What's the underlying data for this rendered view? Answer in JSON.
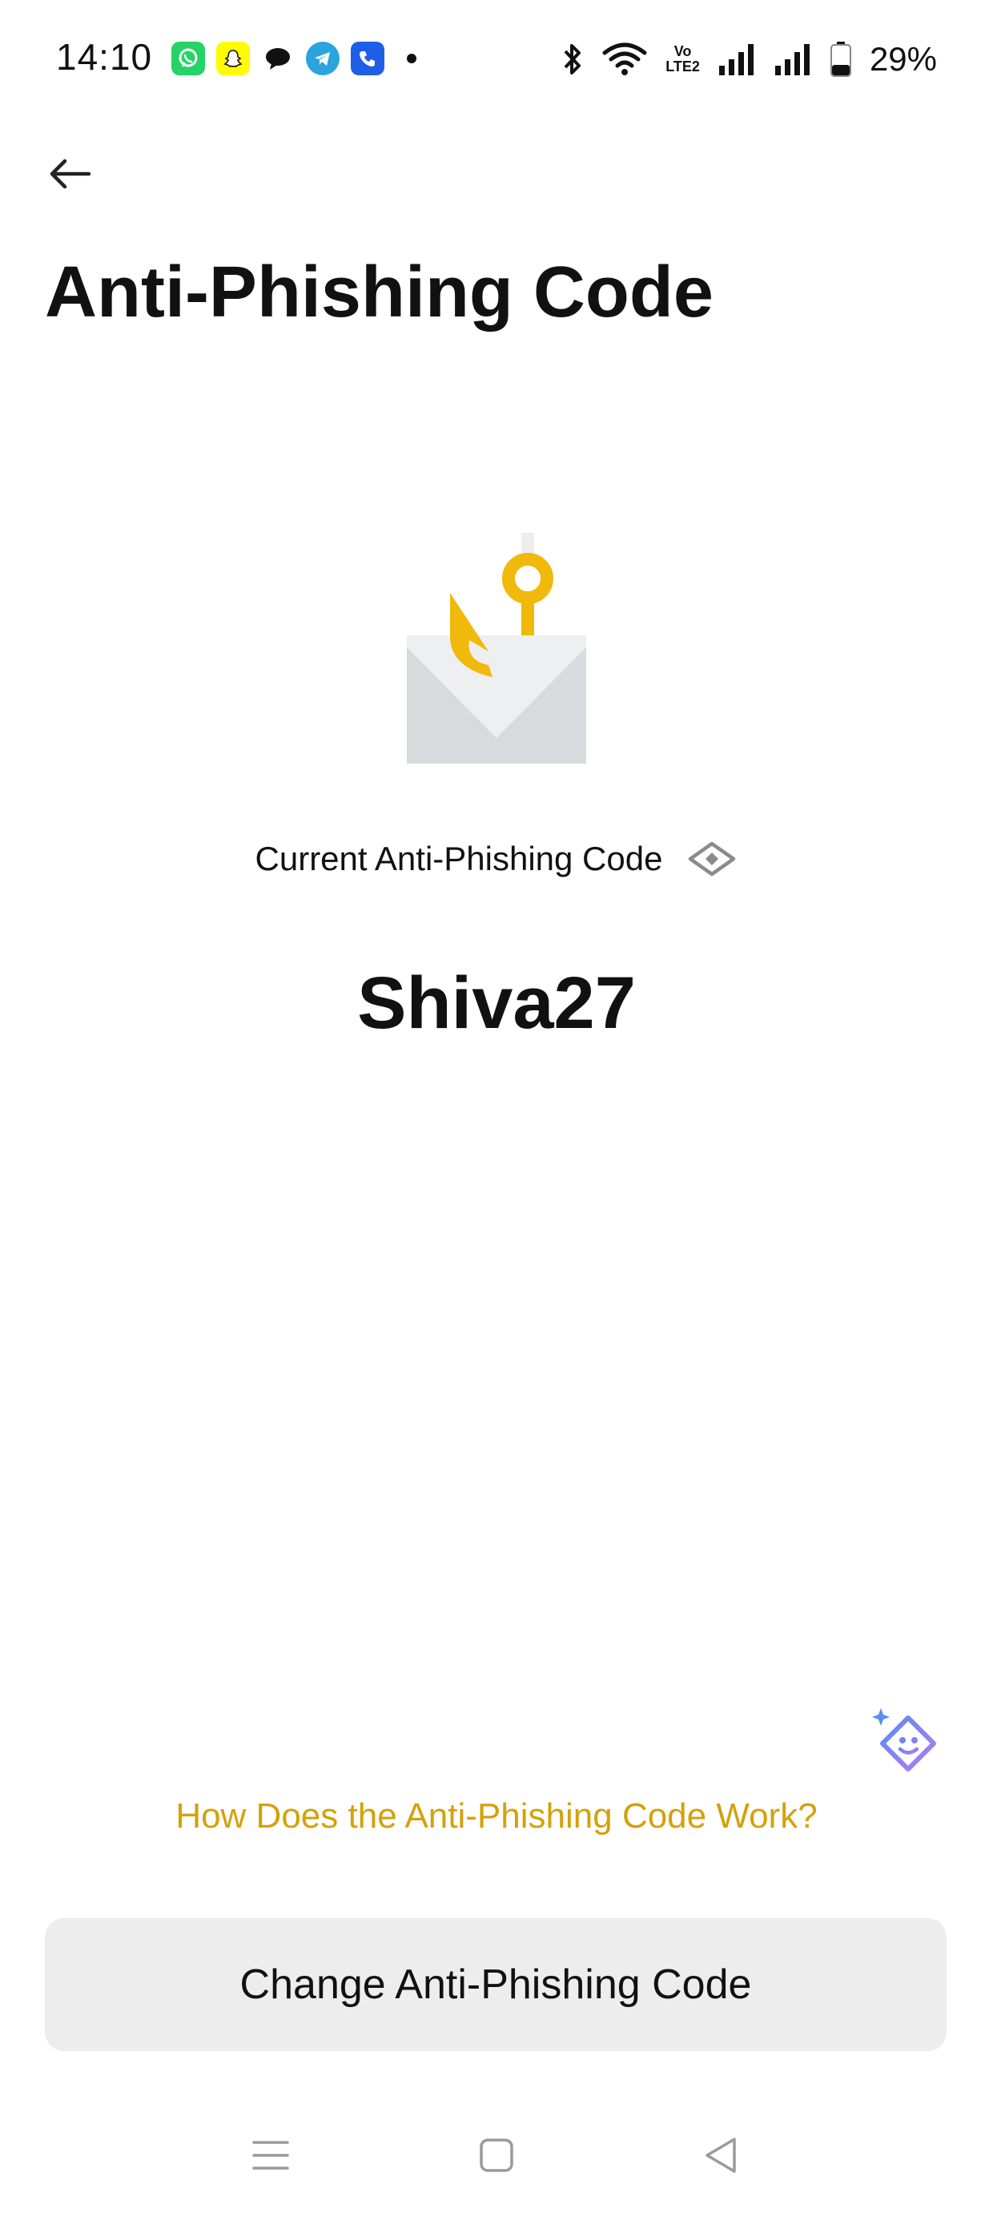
{
  "status_bar": {
    "time": "14:10",
    "battery_percent": "29%",
    "network_badge_top": "Vo",
    "network_badge_bottom": "LTE2",
    "notification_icons": [
      "whatsapp-icon",
      "snapchat-icon",
      "chat-bubble-icon",
      "telegram-icon",
      "phone-app-icon",
      "more-notifications-dot"
    ],
    "system_icons": [
      "bluetooth-icon",
      "wifi-icon",
      "volte-icon",
      "signal-icon",
      "signal-icon",
      "battery-icon"
    ]
  },
  "header": {
    "back_icon": "arrow-left-icon",
    "title": "Anti-Phishing Code"
  },
  "main": {
    "illustration_icon": "envelope-hook-icon",
    "code_label": "Current Anti-Phishing Code",
    "visibility_icon": "eye-icon",
    "code_value": "Shiva27"
  },
  "footer": {
    "assistant_icon": "assistant-face-icon",
    "help_link": "How Does the Anti-Phishing Code Work?",
    "change_button": "Change Anti-Phishing Code"
  },
  "nav_bar": {
    "icons": [
      "menu-icon",
      "home-icon",
      "back-triangle-icon"
    ]
  },
  "colors": {
    "accent": "#d4a10a",
    "hook_yellow": "#f0b90b",
    "button_bg": "#ededed",
    "text": "#111111"
  }
}
